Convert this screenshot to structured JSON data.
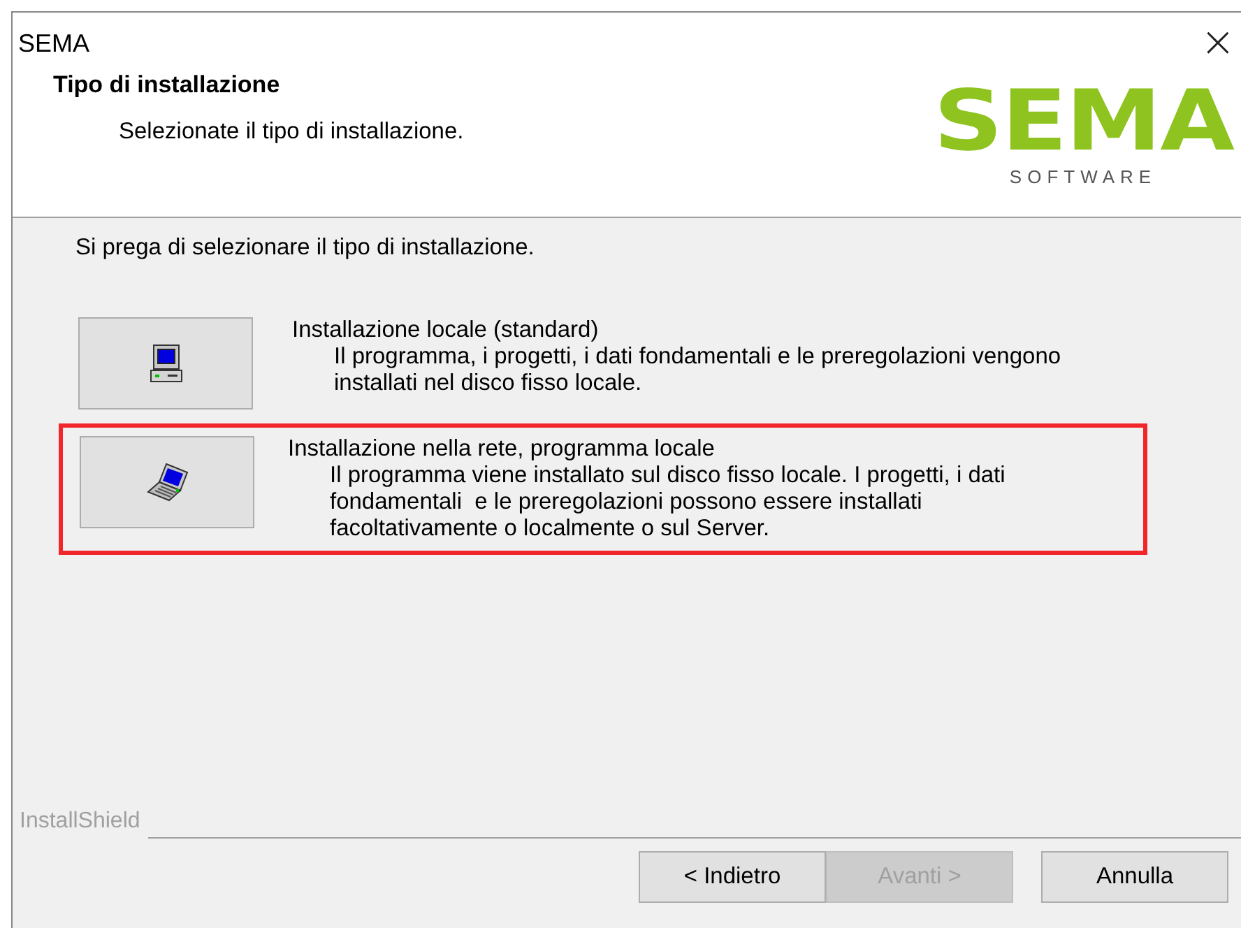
{
  "window": {
    "title": "SEMA",
    "close": "×"
  },
  "header": {
    "title": "Tipo di installazione",
    "subtitle": "Selezionate il tipo di installazione.",
    "logo": {
      "text": "SEMA",
      "tagline": "SOFTWARE"
    }
  },
  "instruction": "Si prega di selezionare il tipo di installazione.",
  "options": [
    {
      "kind": "desktop",
      "title": "Installazione locale (standard)",
      "lines": [
        "Il programma, i progetti, i dati fondamentali e le preregolazioni vengono",
        "installati nel disco fisso locale."
      ],
      "highlighted": false
    },
    {
      "kind": "laptop",
      "title": "Installazione nella rete, programma locale",
      "lines": [
        "Il programma viene installato sul disco fisso locale. I progetti, i dati",
        "fondamentali  e le preregolazioni possono essere installati",
        "facoltativamente o localmente o sul Server."
      ],
      "highlighted": true
    }
  ],
  "brand": "InstallShield",
  "buttons": [
    {
      "label": "< Indietro",
      "disabled": false
    },
    {
      "label": "Avanti >",
      "disabled": true
    },
    {
      "label": "Annulla",
      "disabled": false
    }
  ]
}
